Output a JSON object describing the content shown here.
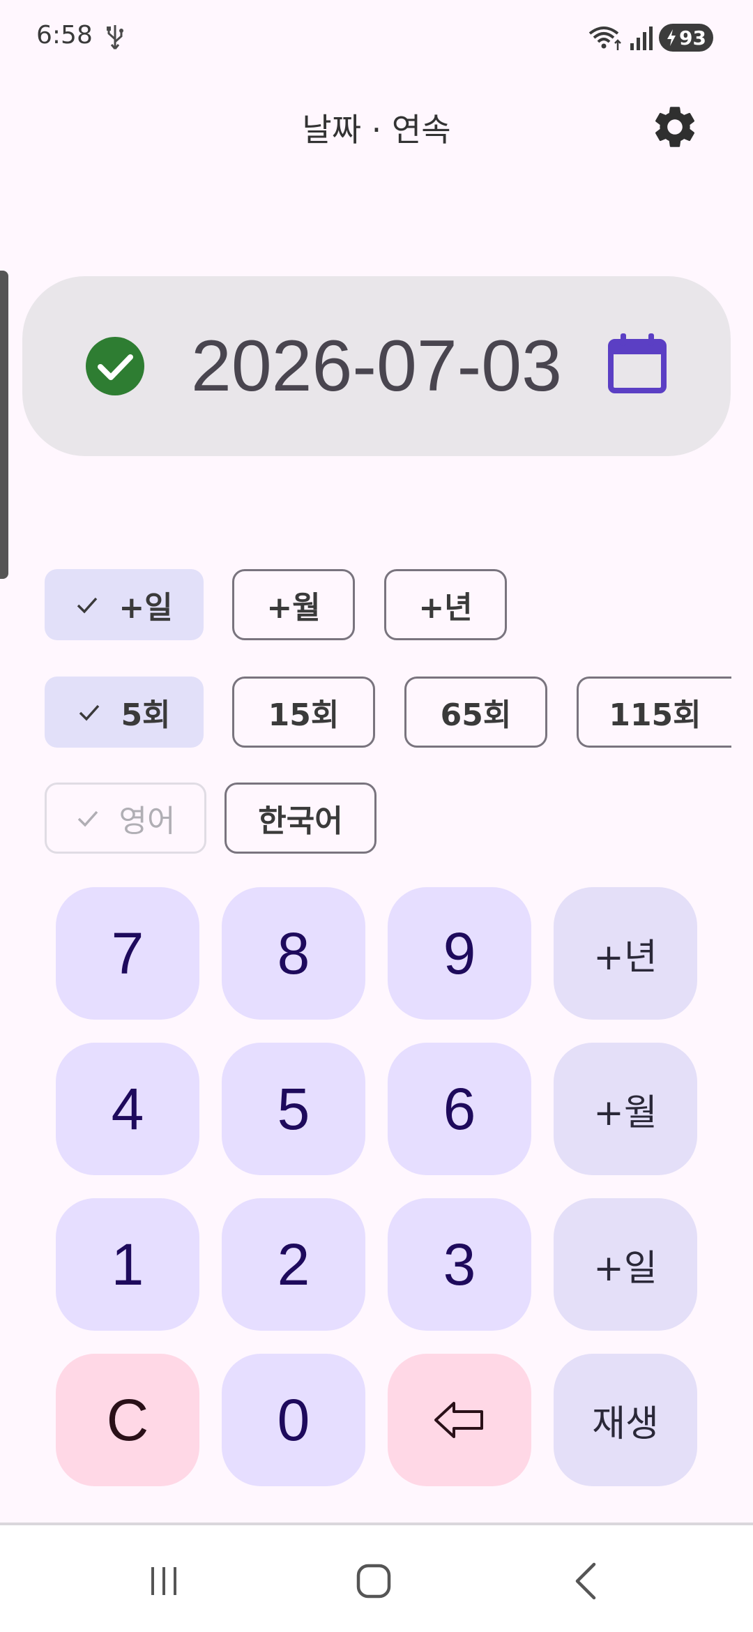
{
  "status_bar": {
    "time": "6:58",
    "battery_level": "93",
    "icons": [
      "usb-icon",
      "wifi-icon",
      "signal-icon",
      "battery-charging-icon"
    ]
  },
  "app_bar": {
    "title": "날짜 · 연속",
    "settings_icon": "gear-icon"
  },
  "date_display": {
    "value": "2026-07-03",
    "status_icon": "check-circle-icon",
    "status_color": "#2E7D32",
    "calendar_icon": "calendar-icon",
    "calendar_color": "#5B3FC4"
  },
  "chips": {
    "unit": [
      {
        "label": "+일",
        "selected": true
      },
      {
        "label": "+월",
        "selected": false
      },
      {
        "label": "+년",
        "selected": false
      }
    ],
    "count": [
      {
        "label": "5회",
        "selected": true
      },
      {
        "label": "15회",
        "selected": false
      },
      {
        "label": "65회",
        "selected": false
      },
      {
        "label": "115회",
        "selected": false
      }
    ],
    "language": [
      {
        "label": "영어",
        "selected": true,
        "disabled": true
      },
      {
        "label": "한국어",
        "selected": false
      }
    ]
  },
  "keypad": {
    "rows": [
      [
        "7",
        "8",
        "9",
        "+년"
      ],
      [
        "4",
        "5",
        "6",
        "+월"
      ],
      [
        "1",
        "2",
        "3",
        "+일"
      ],
      [
        "C",
        "0",
        "backspace-icon",
        "재생"
      ]
    ]
  },
  "colors": {
    "background": "#FFF7FE",
    "chip_selected": "#E2E0F9",
    "key_digit": "#E6DEFF",
    "key_action": "#E4DFF8",
    "key_danger": "#FFD8E6"
  },
  "nav_bar": {
    "icons": [
      "recent-apps-icon",
      "home-icon",
      "back-icon"
    ]
  }
}
